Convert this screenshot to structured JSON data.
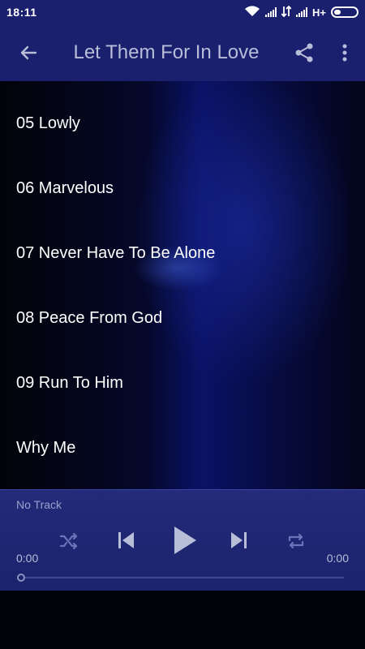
{
  "status_bar": {
    "time": "18:11",
    "network_label": "H+"
  },
  "app_bar": {
    "title": "Let Them For In Love"
  },
  "tracks": [
    "05 Lowly",
    "06 Marvelous",
    "07 Never Have To Be Alone",
    "08 Peace From God",
    "09 Run To Him",
    "Why Me"
  ],
  "player": {
    "now_playing": "No Track",
    "elapsed": "0:00",
    "duration": "0:00",
    "progress": 0
  },
  "colors": {
    "app_bar": "#1a1f6e",
    "player_bg": "#1b236d",
    "title_text": "#b8bdd8",
    "control_icons": "#6c74b8"
  }
}
